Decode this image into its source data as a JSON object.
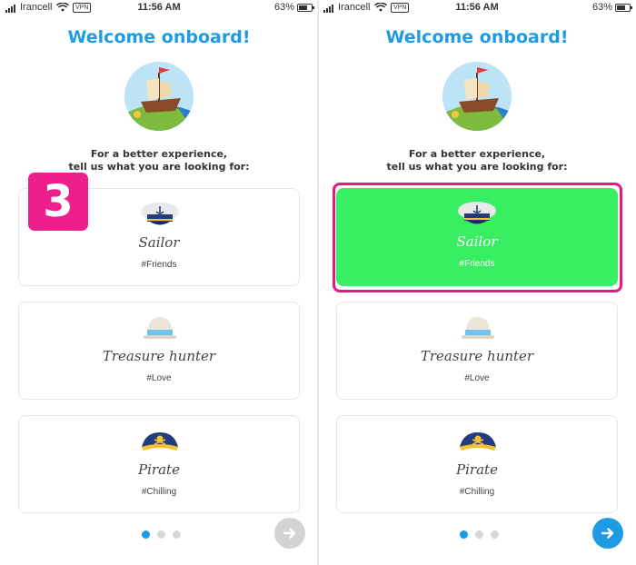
{
  "status_bar": {
    "carrier": "Irancell",
    "vpn": "VPN",
    "time": "11:56 AM",
    "battery_percent": "63%",
    "battery_level": 0.63
  },
  "title": "Welcome onboard!",
  "subtitle_line1": "For a better experience,",
  "subtitle_line2": "tell us what you are looking for:",
  "step_badge": "3",
  "options": [
    {
      "name": "Sailor",
      "tag": "#Friends",
      "icon": "sailor-cap-icon"
    },
    {
      "name": "Treasure hunter",
      "tag": "#Love",
      "icon": "explorer-hat-icon"
    },
    {
      "name": "Pirate",
      "tag": "#Chilling",
      "icon": "pirate-hat-icon"
    }
  ],
  "pagination": {
    "pages": 3,
    "current": 1
  },
  "colors": {
    "accent": "#1e9be3",
    "selected": "#38ef63",
    "highlight": "#e8197c",
    "badge": "#ec1f8c"
  },
  "screens": [
    {
      "selected_option": null,
      "next_enabled": false
    },
    {
      "selected_option": "Sailor",
      "next_enabled": true
    }
  ]
}
